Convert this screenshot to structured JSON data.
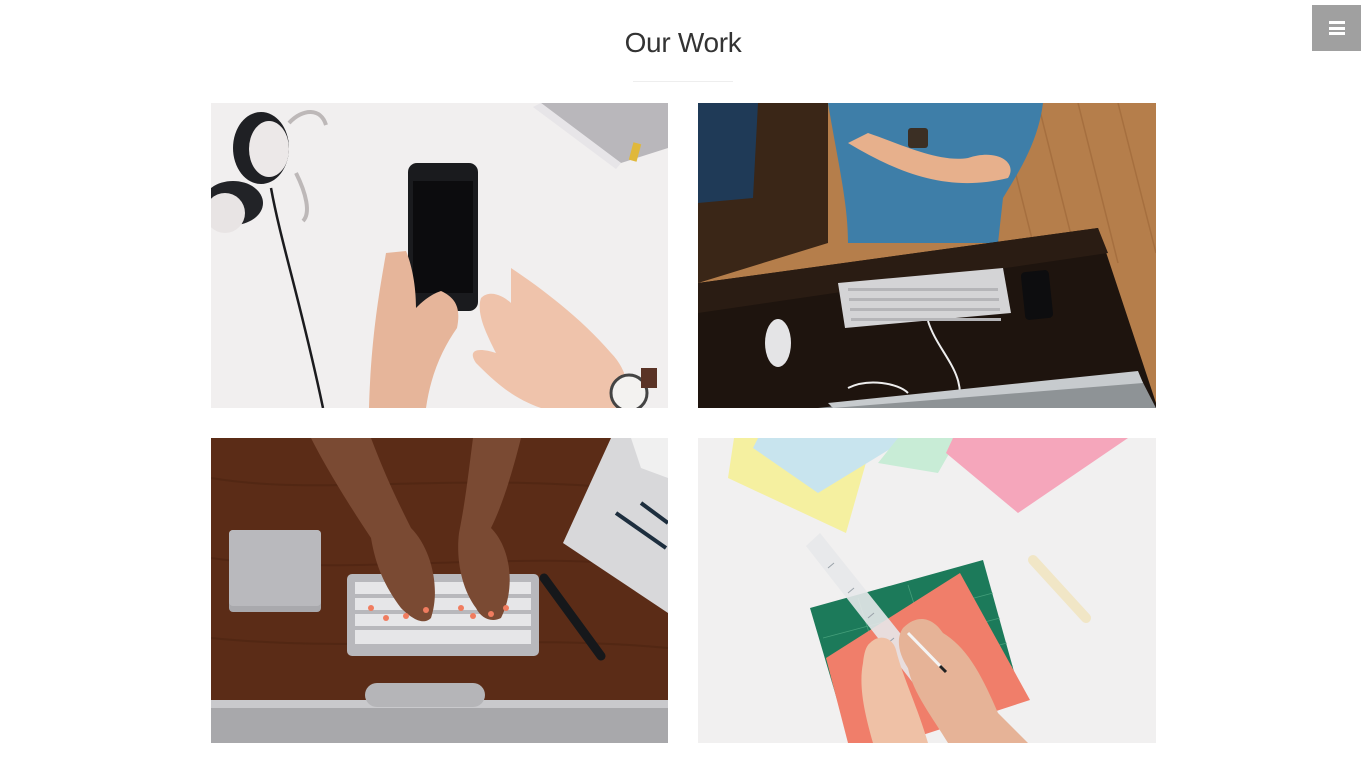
{
  "header": {
    "title": "Our Work",
    "menu_icon": "hamburger-menu-icon"
  },
  "portfolio": {
    "items": [
      {
        "name": "work-item-phone",
        "icon": "photo-hands-holding-smartphone-with-headphones"
      },
      {
        "name": "work-item-desk",
        "icon": "photo-man-at-desk-with-keyboard"
      },
      {
        "name": "work-item-typing",
        "icon": "photo-hands-typing-on-keyboard"
      },
      {
        "name": "work-item-drawing",
        "icon": "photo-hands-drawing-on-paper-with-ruler"
      }
    ]
  },
  "colors": {
    "background": "#ffffff",
    "title": "#333333",
    "menu_button": "#a0a0a0"
  }
}
